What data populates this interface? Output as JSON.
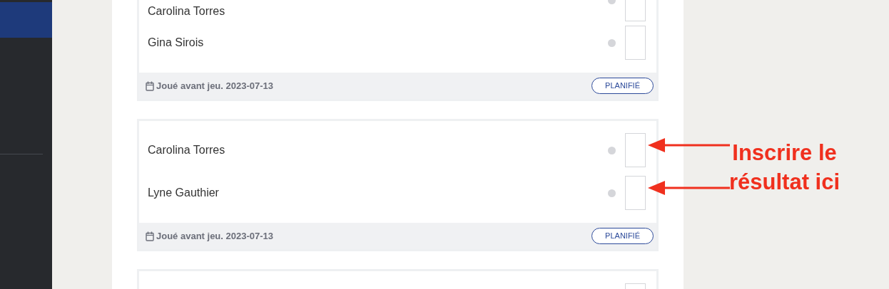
{
  "sidebar": {
    "items": [
      {
        "selected": true
      },
      {
        "selected": false
      }
    ]
  },
  "matches": [
    {
      "players": [
        {
          "kind": "named",
          "name": "Carolina Torres"
        },
        {
          "kind": "named",
          "name": "Gina Sirois"
        }
      ],
      "date": "Joué avant jeu. 2023-07-13",
      "status": "PLANIFIÉ"
    },
    {
      "players": [
        {
          "kind": "named",
          "name": "Carolina Torres",
          "annotated": true
        },
        {
          "kind": "named",
          "name": "Lyne Gauthier",
          "annotated": true
        }
      ],
      "date": "Joué avant jeu. 2023-07-13",
      "status": "PLANIFIÉ"
    },
    {
      "players": [
        {
          "kind": "unlabeled"
        }
      ]
    }
  ],
  "annotation": {
    "lines": [
      "Inscrire le",
      "résultat ici"
    ]
  }
}
